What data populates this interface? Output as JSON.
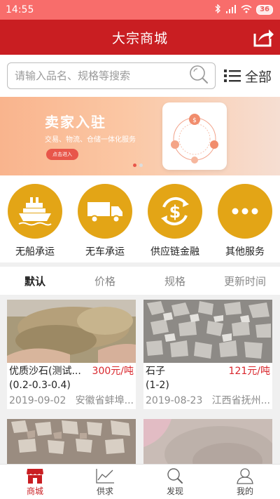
{
  "status_bar": {
    "time": "14:55",
    "battery": "36"
  },
  "header": {
    "title": "大宗商城"
  },
  "search": {
    "placeholder": "请输入品名、规格等搜索",
    "all_label": "全部"
  },
  "banner": {
    "title": "卖家入驻",
    "subtitle": "交易、物流、仓储一体化服务",
    "button": "点击进入"
  },
  "services": [
    {
      "label": "无船承运",
      "icon": "ship-icon"
    },
    {
      "label": "无车承运",
      "icon": "truck-icon"
    },
    {
      "label": "供应链金融",
      "icon": "dollar-cycle-icon"
    },
    {
      "label": "其他服务",
      "icon": "more-dots-icon"
    }
  ],
  "tabs": [
    {
      "label": "默认",
      "active": true
    },
    {
      "label": "价格"
    },
    {
      "label": "规格"
    },
    {
      "label": "更新时间"
    }
  ],
  "products": [
    {
      "name": "优质沙石(测试...",
      "price": "300元/吨",
      "spec": "(0.2-0.3-0.4)",
      "date": "2019-09-02",
      "location": "安徽省蚌埠..."
    },
    {
      "name": "石子",
      "price": "121元/吨",
      "spec": "(1-2)",
      "date": "2019-08-23",
      "location": "江西省抚州..."
    }
  ],
  "bottom_nav": [
    {
      "label": "商城",
      "icon": "store-icon",
      "active": true
    },
    {
      "label": "供求",
      "icon": "chart-icon"
    },
    {
      "label": "发现",
      "icon": "discover-search-icon"
    },
    {
      "label": "我的",
      "icon": "user-icon"
    }
  ],
  "colors": {
    "brand_red": "#c91e22",
    "status_bar": "#f86d6b",
    "service_gold": "#e3a516",
    "price_red": "#d9262c"
  }
}
